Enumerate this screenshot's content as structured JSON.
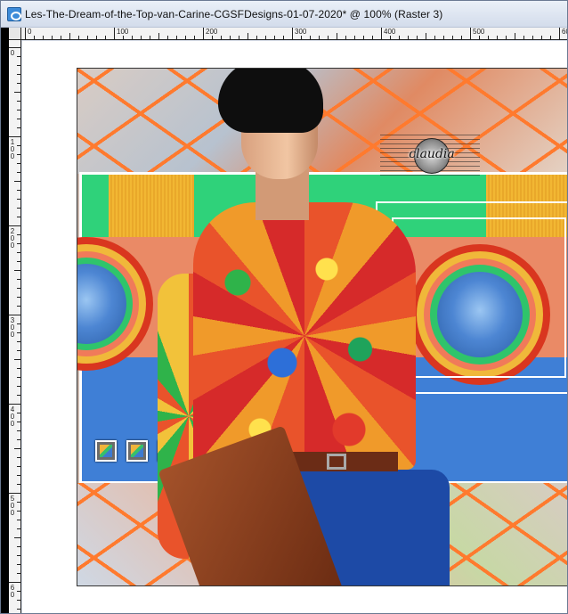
{
  "window": {
    "title": "Les-The-Dream-of-the-Top-van-Carine-CGSFDesigns-01-07-2020* @ 100% (Raster 3)"
  },
  "ruler": {
    "horizontal_labels": [
      "0",
      "100",
      "200",
      "300",
      "400",
      "500",
      "600"
    ],
    "vertical_labels": [
      "0",
      "1 0 0",
      "2 0 0",
      "3 0 0",
      "4 0 0",
      "5 0 0",
      "6 0"
    ]
  },
  "canvas": {
    "watermark_text": "claudia"
  },
  "colors": {
    "title_bar": "#dfe6f1",
    "ruler_bg": "#f3f3f3",
    "canvas_bg": "#ffffff",
    "accent_orange": "#ff7a2e",
    "green_band": "#2fd27a",
    "blue_band": "#3f7fd6"
  },
  "icons": {
    "app": "paint-shop-icon"
  }
}
